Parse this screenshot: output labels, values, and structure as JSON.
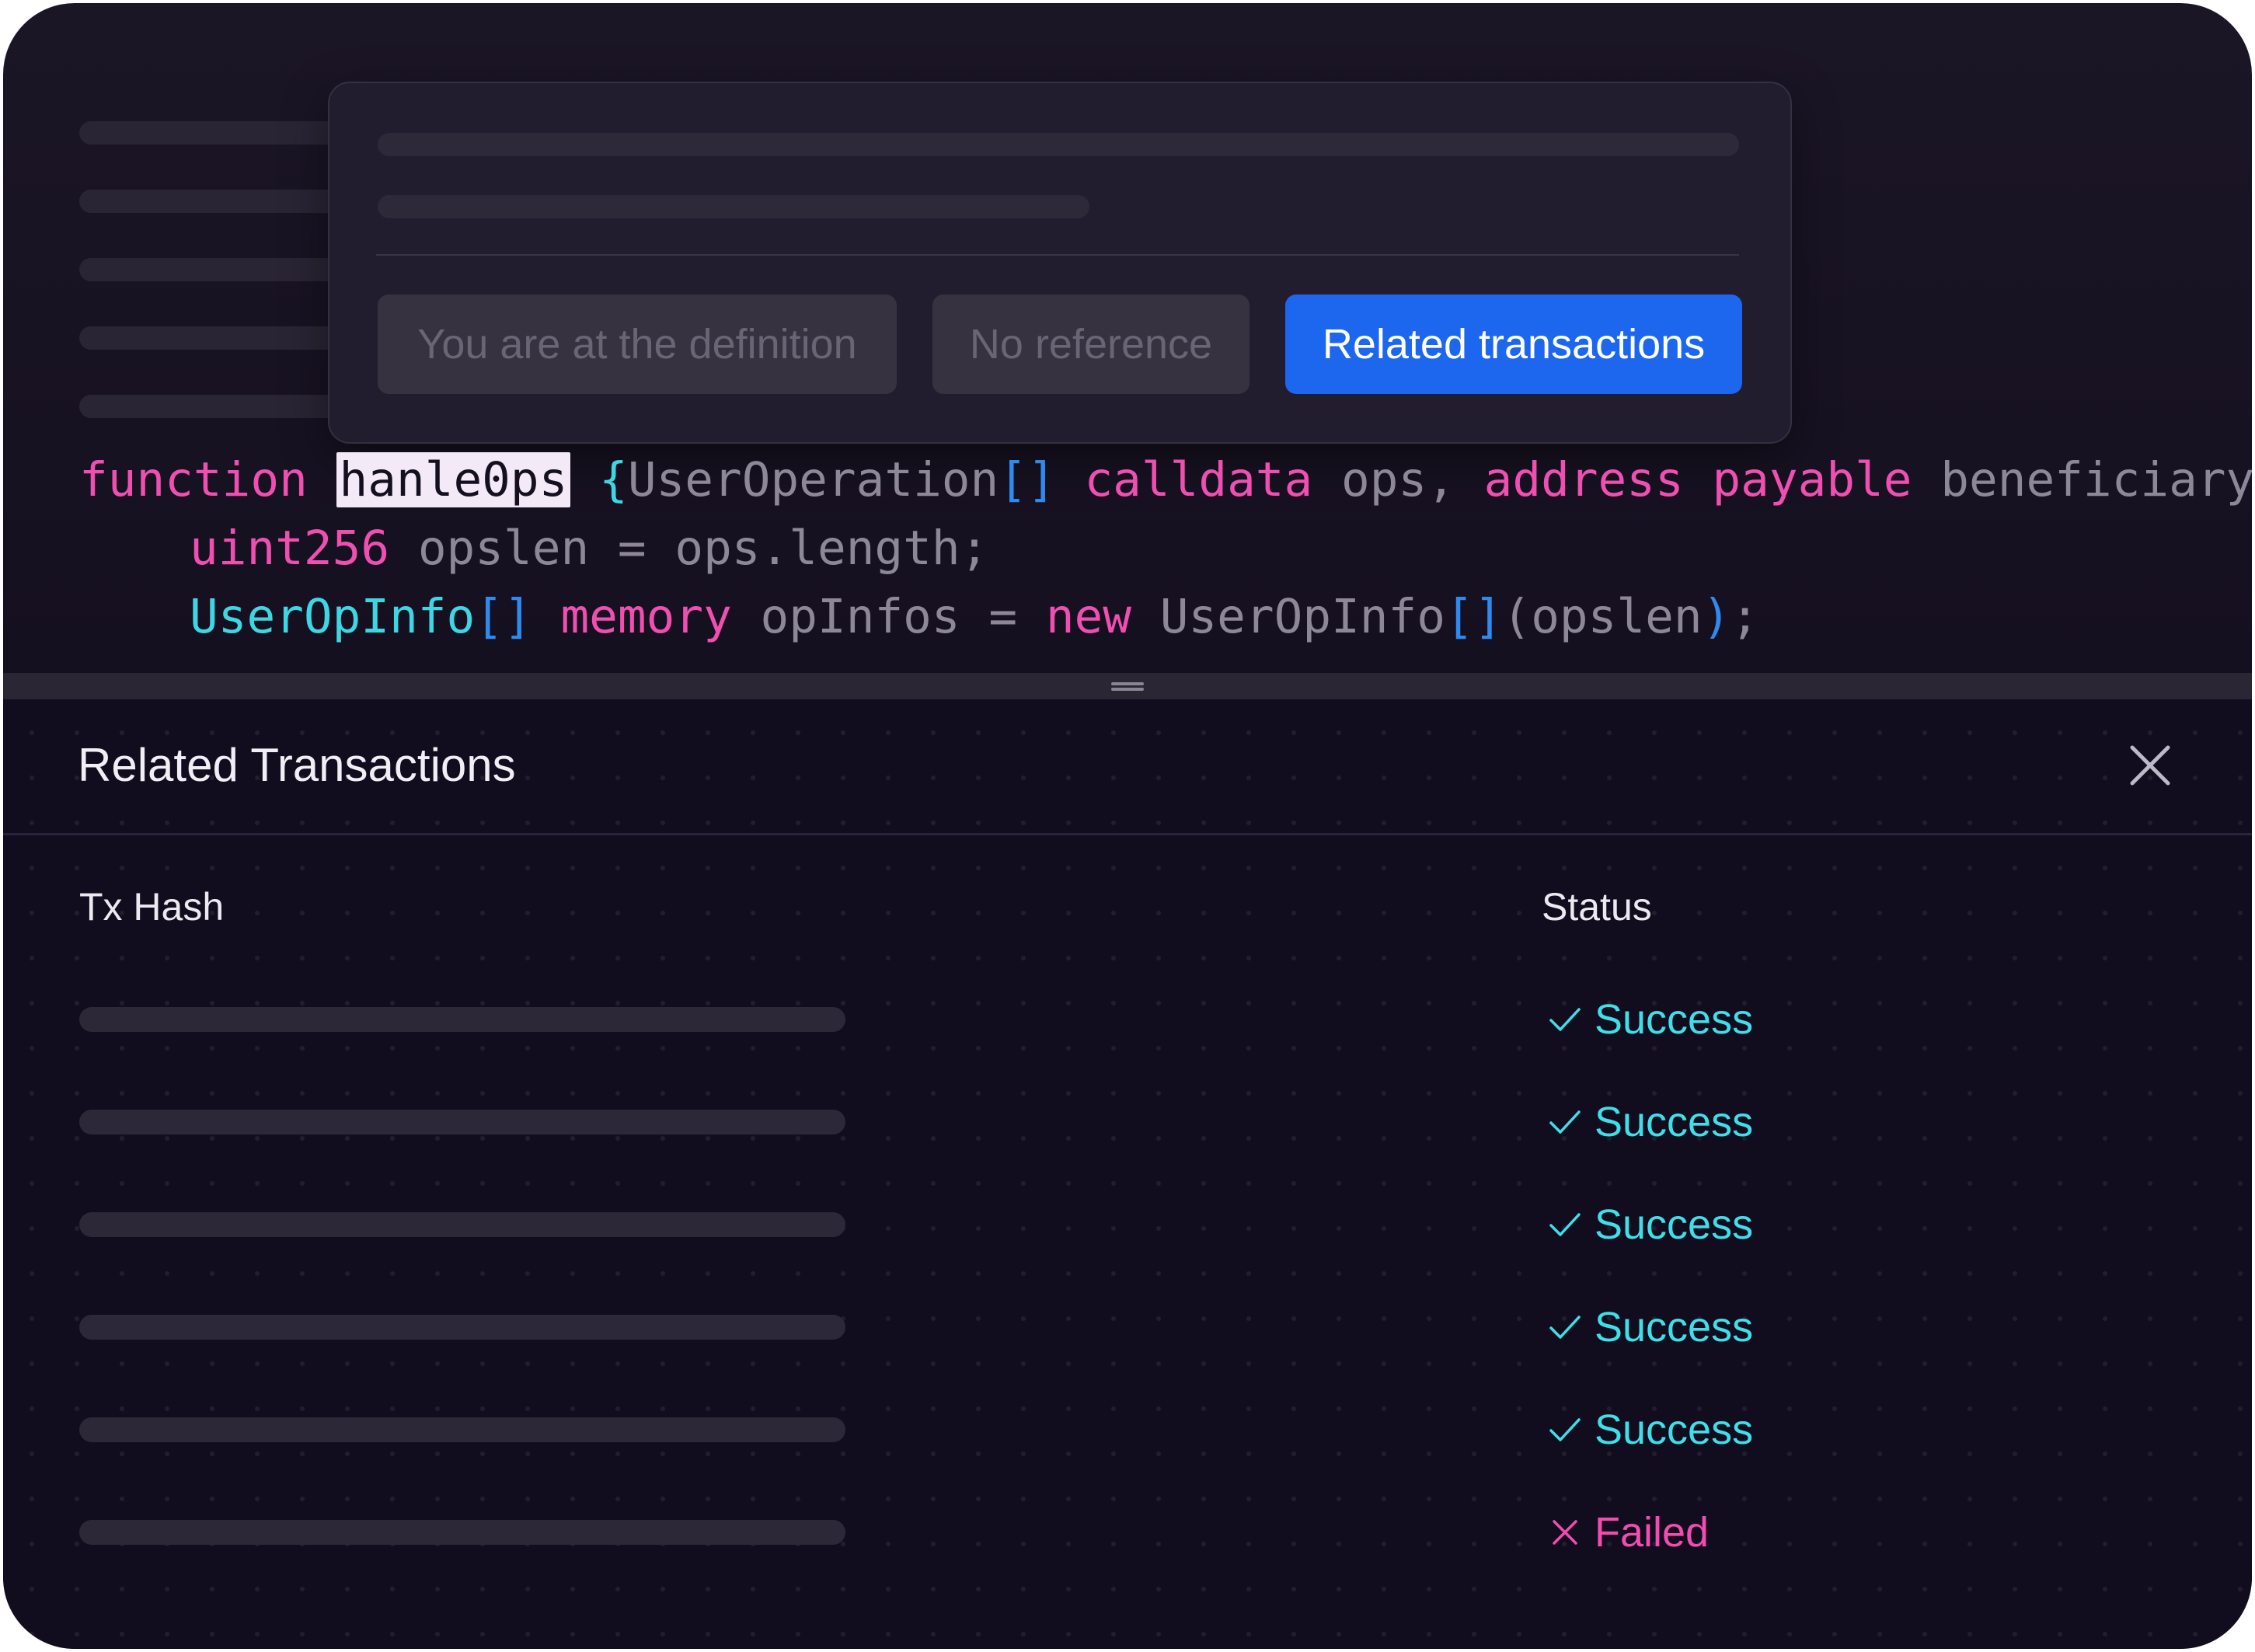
{
  "popup": {
    "buttons": [
      {
        "label": "You are at the definition",
        "state": "disabled"
      },
      {
        "label": "No reference",
        "state": "disabled"
      },
      {
        "label": "Related transactions",
        "state": "active"
      }
    ]
  },
  "code": {
    "line1": {
      "kw": "function",
      "fn_name": "hanle0ps",
      "brace_open": "{",
      "type1": "UserOperation",
      "arr1": "[]",
      "mod1": "calldata",
      "var1": "ops,",
      "mod2": "address",
      "mod3": "payable",
      "var2": "beneficiary",
      "brace_close": "}"
    },
    "line2": {
      "type": "uint256",
      "rest": "opslen = ops.length;"
    },
    "line3": {
      "type": "UserOpInfo",
      "arr": "[]",
      "mod": "memory",
      "var": "opInfos =",
      "kw_new": "new",
      "type2": "UserOpInfo",
      "arr2": "[]",
      "paren_open": "(",
      "arg": "opslen",
      "paren_close": ")",
      "semi": ";"
    }
  },
  "panel": {
    "title": "Related Transactions",
    "columns": {
      "hash": "Tx Hash",
      "status": "Status"
    },
    "rows": [
      {
        "status": "Success",
        "icon": "check-icon"
      },
      {
        "status": "Success",
        "icon": "check-icon"
      },
      {
        "status": "Success",
        "icon": "check-icon"
      },
      {
        "status": "Success",
        "icon": "check-icon"
      },
      {
        "status": "Success",
        "icon": "check-icon"
      },
      {
        "status": "Failed",
        "icon": "x-icon"
      }
    ]
  },
  "colors": {
    "keyword": "#ef4fb1",
    "type": "#3fd6e4",
    "bracket": "#2f8af0",
    "primary_button": "#1d66ee",
    "success": "#3fdfe9",
    "failed": "#f14cae"
  }
}
